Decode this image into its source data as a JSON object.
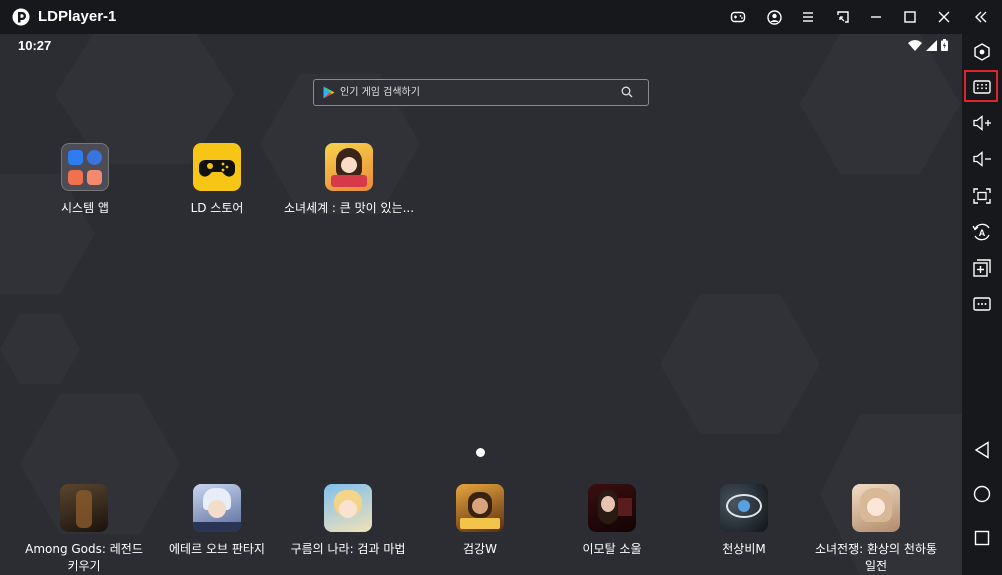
{
  "window": {
    "title": "LDPlayer-1"
  },
  "statusbar": {
    "time": "10:27"
  },
  "search": {
    "placeholder": "인기 게임 검색하기"
  },
  "home_apps": [
    {
      "label": "시스템 앱",
      "icon": "system-apps-folder-icon"
    },
    {
      "label": "LD 스토어",
      "icon": "ld-store-icon"
    },
    {
      "label": "소녀세계 : 큰 맛이 있는...",
      "icon": "girl-world-game-icon"
    }
  ],
  "dock_apps": [
    {
      "label": "Among Gods: 레전드 키우기",
      "icon": "among-gods-icon"
    },
    {
      "label": "에테르 오브 판타지",
      "icon": "ether-of-fantasy-icon"
    },
    {
      "label": "구름의 나라: 검과 마법",
      "icon": "cloud-country-icon"
    },
    {
      "label": "검강W",
      "icon": "geomgang-w-icon"
    },
    {
      "label": "이모탈 소울",
      "icon": "immortal-soul-icon"
    },
    {
      "label": "천상비M",
      "icon": "cheonsangbi-m-icon"
    },
    {
      "label": "소녀전쟁: 환상의 천하통일전",
      "icon": "girl-war-icon"
    }
  ],
  "titlebar_buttons": [
    "gamepad-icon",
    "account-icon",
    "menu-icon",
    "minimize-to-window-icon",
    "minimize-icon",
    "maximize-icon",
    "close-icon",
    "collapse-sidebar-icon"
  ],
  "sidebar_buttons": [
    "settings-hex-icon",
    "keyboard-mapping-icon",
    "volume-up-icon",
    "volume-down-icon",
    "screenshot-icon",
    "auto-rotate-icon",
    "add-instance-icon",
    "more-icon",
    "back-icon",
    "home-icon",
    "recents-icon"
  ],
  "colors": {
    "highlight": "#e0242a",
    "ld_store": "#f7c515"
  }
}
